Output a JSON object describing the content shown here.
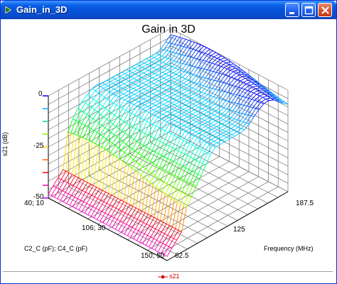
{
  "window": {
    "title": "Gain_in_3D",
    "buttons": [
      "minimize",
      "maximize",
      "close"
    ]
  },
  "chart_data": {
    "type": "surface",
    "title": "Gain in 3D",
    "zlabel": "s21 (dB)",
    "z_ticks": [
      "0",
      "-25",
      "-50"
    ],
    "zlim": [
      -50,
      0
    ],
    "x_axis_label": "C2_C (pF); C4_C (pF)",
    "x_ticks": [
      "40; 10",
      "106; 30",
      "150; 50"
    ],
    "y_axis_label": "Frequency (MHz)",
    "y_ticks": [
      "62.5",
      "125",
      "187.5"
    ],
    "ylim": [
      62.5,
      187.5
    ],
    "colormap": [
      "#ff00ff",
      "#ff0000",
      "#ffff00",
      "#00ff00",
      "#00ffff",
      "#0000ff"
    ],
    "legend": [
      {
        "name": "s21",
        "color": "#d40000"
      }
    ],
    "grid": true
  }
}
